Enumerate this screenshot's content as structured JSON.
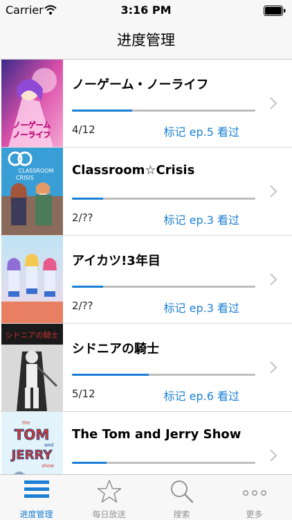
{
  "status_bar": {
    "carrier": "Carrier",
    "time": "3:16 PM",
    "wifi_icon": "wifi-icon",
    "battery_icon": "battery-icon"
  },
  "nav": {
    "title": "进度管理"
  },
  "colors": {
    "accent": "#1a7fd4",
    "track": "#bdbdbd",
    "inactive_tab": "#929292"
  },
  "items": [
    {
      "title": "ノーゲーム・ノーライフ",
      "progress": "4/12",
      "progress_fraction": 0.33,
      "action": "标记 ep.5 看过"
    },
    {
      "title": "Classroom☆Crisis",
      "progress": "2/??",
      "progress_fraction": 0.17,
      "action": "标记 ep.3 看过"
    },
    {
      "title": "アイカツ!3年目",
      "progress": "2/??",
      "progress_fraction": 0.17,
      "action": "标记 ep.3 看过"
    },
    {
      "title": "シドニアの騎士",
      "progress": "5/12",
      "progress_fraction": 0.42,
      "action": "标记 ep.6 看过"
    },
    {
      "title": "The Tom and Jerry Show",
      "progress": "",
      "progress_fraction": 0.19,
      "action": ""
    }
  ],
  "covers": [
    {
      "lines": [
        "ノーゲーム",
        "ノーライフ"
      ]
    },
    {
      "lines": [
        "CLASSROOM",
        "CRISIS"
      ]
    },
    {
      "lines": []
    },
    {
      "lines": [
        "シドニアの騎士"
      ]
    },
    {
      "lines": [
        "the",
        "TOM",
        "and",
        "JERRY",
        "show"
      ]
    }
  ],
  "tabs": [
    {
      "label": "进度管理",
      "icon": "list-icon",
      "active": true
    },
    {
      "label": "每日放送",
      "icon": "star-icon",
      "active": false
    },
    {
      "label": "搜索",
      "icon": "search-icon",
      "active": false
    },
    {
      "label": "更多",
      "icon": "more-icon",
      "active": false
    }
  ]
}
